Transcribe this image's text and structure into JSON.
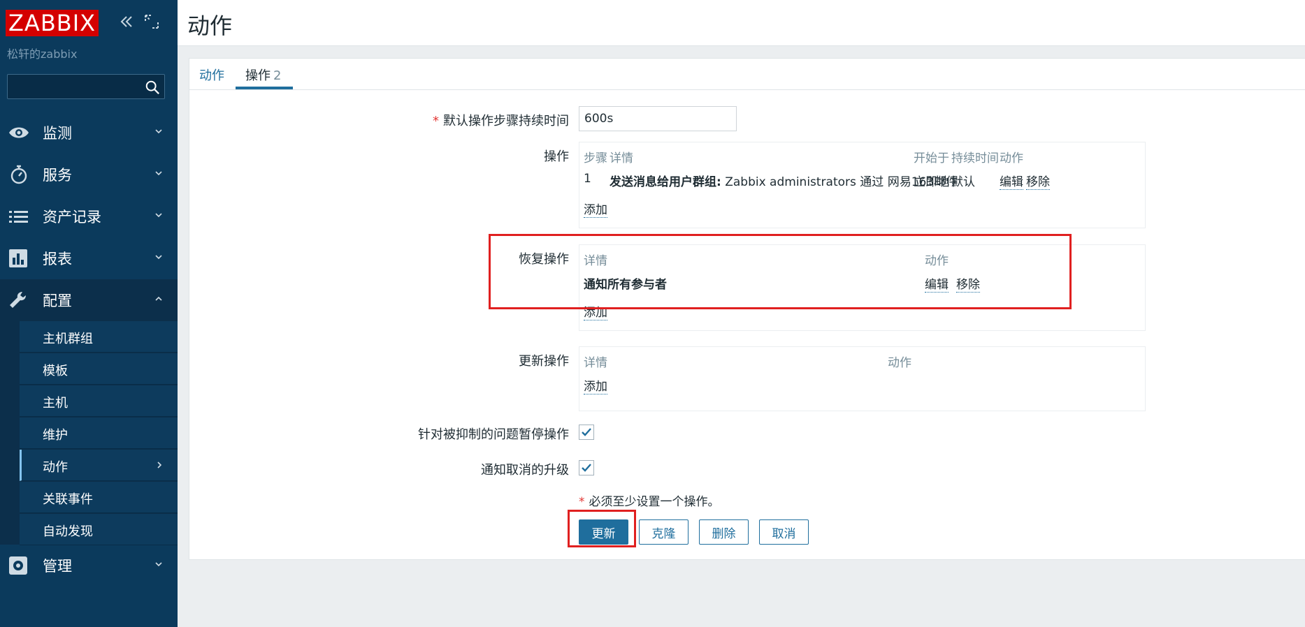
{
  "sidebar": {
    "logo": "ZABBIX",
    "server_name": "松轩的zabbix",
    "search": {
      "value": "",
      "placeholder": ""
    },
    "menu": [
      {
        "label": "监测",
        "icon": "eye-icon"
      },
      {
        "label": "服务",
        "icon": "stopwatch-icon"
      },
      {
        "label": "资产记录",
        "icon": "list-icon"
      },
      {
        "label": "报表",
        "icon": "bar-chart-icon"
      },
      {
        "label": "配置",
        "icon": "wrench-icon"
      },
      {
        "label": "管理",
        "icon": "gear-icon"
      }
    ],
    "submenu": [
      {
        "label": "主机群组"
      },
      {
        "label": "模板"
      },
      {
        "label": "主机"
      },
      {
        "label": "维护"
      },
      {
        "label": "动作"
      },
      {
        "label": "关联事件"
      },
      {
        "label": "自动发现"
      }
    ]
  },
  "header": {
    "title": "动作"
  },
  "tabs": [
    {
      "label": "动作"
    },
    {
      "label": "操作",
      "count": "2"
    }
  ],
  "form": {
    "duration_label": "默认操作步骤持续时间",
    "duration_value": "600s",
    "operations": {
      "label": "操作",
      "headers": {
        "step": "步骤",
        "details": "详情",
        "start": "开始于",
        "duration": "持续时间",
        "action": "动作"
      },
      "rows": [
        {
          "step": "1",
          "details_bold": "发送消息给用户群组:",
          "details_rest": " Zabbix administrators 通过 网易163邮件",
          "start": "立即地",
          "duration": "默认",
          "edit": "编辑",
          "remove": "移除"
        }
      ],
      "add": "添加"
    },
    "recovery": {
      "label": "恢复操作",
      "headers": {
        "details": "详情",
        "action": "动作"
      },
      "rows": [
        {
          "details": "通知所有参与者",
          "edit": "编辑",
          "remove": "移除"
        }
      ],
      "add": "添加"
    },
    "update_ops": {
      "label": "更新操作",
      "headers": {
        "details": "详情",
        "action": "动作"
      },
      "add": "添加"
    },
    "pause_suppressed_label": "针对被抑制的问题暂停操作",
    "notify_cancelled_label": "通知取消的升级",
    "required_note": "必须至少设置一个操作。",
    "required_marker": "*"
  },
  "buttons": {
    "update": "更新",
    "clone": "克隆",
    "delete": "删除",
    "cancel": "取消"
  },
  "colors": {
    "sidebar": "#0b3a5c",
    "accent": "#1f6e9d",
    "logo": "#d40000",
    "highlight": "#e02020"
  }
}
